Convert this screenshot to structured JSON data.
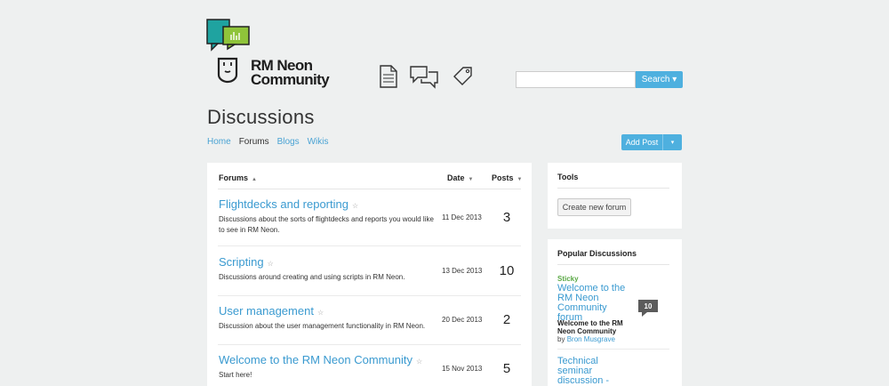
{
  "brand": {
    "line1": "RM Neon",
    "line2": "Community"
  },
  "search": {
    "placeholder": "",
    "button_label": "Search ▾"
  },
  "page_title": "Discussions",
  "tabs": [
    {
      "label": "Home",
      "active": false
    },
    {
      "label": "Forums",
      "active": true
    },
    {
      "label": "Blogs",
      "active": false
    },
    {
      "label": "Wikis",
      "active": false
    }
  ],
  "add_post": {
    "label": "Add Post",
    "caret": "▾"
  },
  "forums_table": {
    "headers": {
      "forums": "Forums",
      "date": "Date",
      "posts": "Posts"
    },
    "rows": [
      {
        "title": "Flightdecks and reporting",
        "desc": "Discussions about the sorts of flightdecks and reports you would like to see in RM Neon.",
        "date": "11 Dec 2013",
        "posts": "3"
      },
      {
        "title": "Scripting",
        "desc": "Discussions around creating and using scripts in RM Neon.",
        "date": "13 Dec 2013",
        "posts": "10"
      },
      {
        "title": "User management",
        "desc": "Discussion about the user management functionality in RM Neon.",
        "date": "20 Dec 2013",
        "posts": "2"
      },
      {
        "title": "Welcome to the RM Neon Community",
        "desc": "Start here!",
        "date": "15 Nov 2013",
        "posts": "5"
      }
    ]
  },
  "tools": {
    "title": "Tools",
    "create_forum": "Create new forum"
  },
  "popular": {
    "title": "Popular Discussions",
    "items": [
      {
        "tag": "Sticky",
        "title": "Welcome to the RM Neon Community forum",
        "subtitle": "Welcome to the RM Neon Community",
        "by_label": "by",
        "author": "Bron Musgrave",
        "count": "10"
      },
      {
        "title": "Technical seminar discussion - what flightdeck"
      }
    ]
  },
  "colors": {
    "accent": "#4eb0df",
    "link": "#3a9ad0",
    "sticky": "#5aa845",
    "logo_teal": "#1fa3a0",
    "logo_green": "#8fc43a"
  },
  "icons": [
    "document-icon",
    "chat-bubbles-icon",
    "tag-icon",
    "star-icon"
  ]
}
